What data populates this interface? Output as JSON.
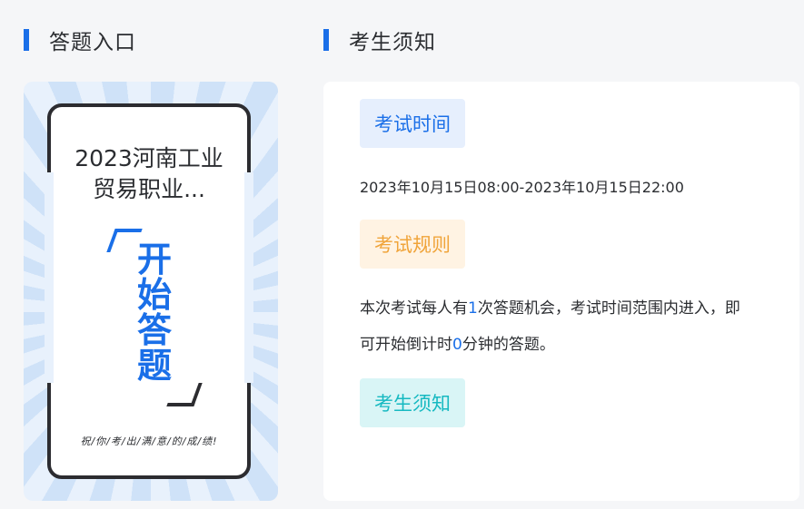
{
  "left_section": {
    "title": "答题入口"
  },
  "right_section": {
    "title": "考生须知"
  },
  "entry_card": {
    "exam_title": "2023河南工业贸易职业...",
    "start_label": "开始答题",
    "wish": "祝/你/考/出/满/意/的/成/绩!"
  },
  "notice": {
    "time_tag": "考试时间",
    "time_value": "2023年10月15日08:00-2023年10月15日22:00",
    "rule_tag": "考试规则",
    "rule_part1": "本次考试每人有",
    "rule_chances": "1",
    "rule_part2": "次答题机会，考试时间范围内进入，即可开始倒计时",
    "rule_minutes": "0",
    "rule_part3": "分钟的答题。",
    "know_tag": "考生须知"
  },
  "colors": {
    "accent_blue": "#1a6fe8",
    "rule_orange": "#f0a43a",
    "know_teal": "#16b9c1",
    "text_dark": "#2b2d31"
  }
}
